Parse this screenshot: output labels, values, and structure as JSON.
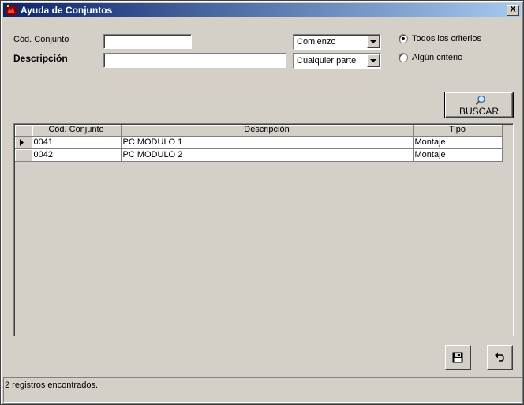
{
  "window": {
    "title": "Ayuda de Conjuntos",
    "close_label": "X",
    "accent_color": "#0a246a"
  },
  "filters": {
    "code_label": "Cód. Conjunto",
    "code_value": "",
    "code_match": "Comienzo",
    "description_label": "Descripción",
    "description_value": "",
    "description_match": "Cualquier parte",
    "criteria_options": [
      {
        "label": "Todos los criterios",
        "selected": true
      },
      {
        "label": "Algún criterio",
        "selected": false
      }
    ]
  },
  "search_button": {
    "label": "BUSCAR",
    "icon": "magnifier-icon"
  },
  "grid": {
    "columns": [
      "Cód. Conjunto",
      "Descripción",
      "Tipo"
    ],
    "rows": [
      {
        "code": "0041",
        "description": "PC MODULO 1",
        "type": "Montaje",
        "current": true
      },
      {
        "code": "0042",
        "description": "PC MODULO 2",
        "type": "Montaje",
        "current": false
      }
    ]
  },
  "actions": {
    "save_icon": "floppy-disk-icon",
    "undo_icon": "undo-arrow-icon"
  },
  "status": {
    "text": "2 registros encontrados."
  }
}
